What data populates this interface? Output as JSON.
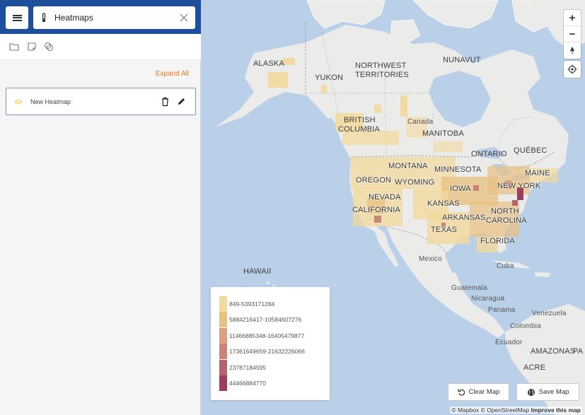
{
  "sidebar": {
    "search": {
      "value": "Heatmaps",
      "placeholder": ""
    },
    "expand_all_label": "Expand All",
    "layers": [
      {
        "name": "New Heatmap"
      }
    ]
  },
  "map": {
    "labels": {
      "alaska": "ALASKA",
      "yukon": "YUKON",
      "northwest1": "NORTHWEST",
      "northwest2": "TERRITORIES",
      "nunavut": "NUNAVUT",
      "bc1": "BRITISH",
      "bc2": "COLUMBIA",
      "canada": "Canada",
      "manitoba": "MANITOBA",
      "ontario": "ONTARIO",
      "quebec": "QUÉBEC",
      "montana": "MONTANA",
      "minnesota": "MINNESOTA",
      "maine": "MAINE",
      "oregon": "OREGON",
      "wyoming": "WYOMING",
      "iowa": "IOWA",
      "newyork": "NEW YORK",
      "nevada": "NEVADA",
      "kansas": "KANSAS",
      "california": "CALIFORNIA",
      "arkansas": "ARKANSAS",
      "northcarolina1": "NORTH",
      "northcarolina2": "CAROLINA",
      "texas": "TEXAS",
      "florida": "FLORIDA",
      "hawaii": "HAWAII",
      "mexico": "Mexico",
      "cuba": "Cuba",
      "guatemala": "Guatemala",
      "nicaragua": "Nicaragua",
      "panama": "Panama",
      "venezuela": "Venezuela",
      "colombia": "Colombia",
      "ecuador": "Ecuador",
      "amazonas": "AMAZONAS",
      "acre": "ACRE",
      "pa": "PA"
    },
    "legend": [
      {
        "label": "849-5393171284",
        "color": "#f3d99b"
      },
      {
        "label": "5884216417-10584607276",
        "color": "#e8c285"
      },
      {
        "label": "11466885348-16405479877",
        "color": "#d9a27c"
      },
      {
        "label": "17361649659-21632226066",
        "color": "#c98577"
      },
      {
        "label": "23787184595",
        "color": "#b4646d"
      },
      {
        "label": "44466884770",
        "color": "#9b3f5c"
      }
    ],
    "buttons": {
      "clear": "Clear Map",
      "save": "Save Map"
    },
    "zoom_in": "+",
    "zoom_out": "−",
    "attribution": {
      "mapbox": "© Mapbox",
      "osm": "© OpenStreetMap",
      "improve": "Improve this map"
    }
  }
}
